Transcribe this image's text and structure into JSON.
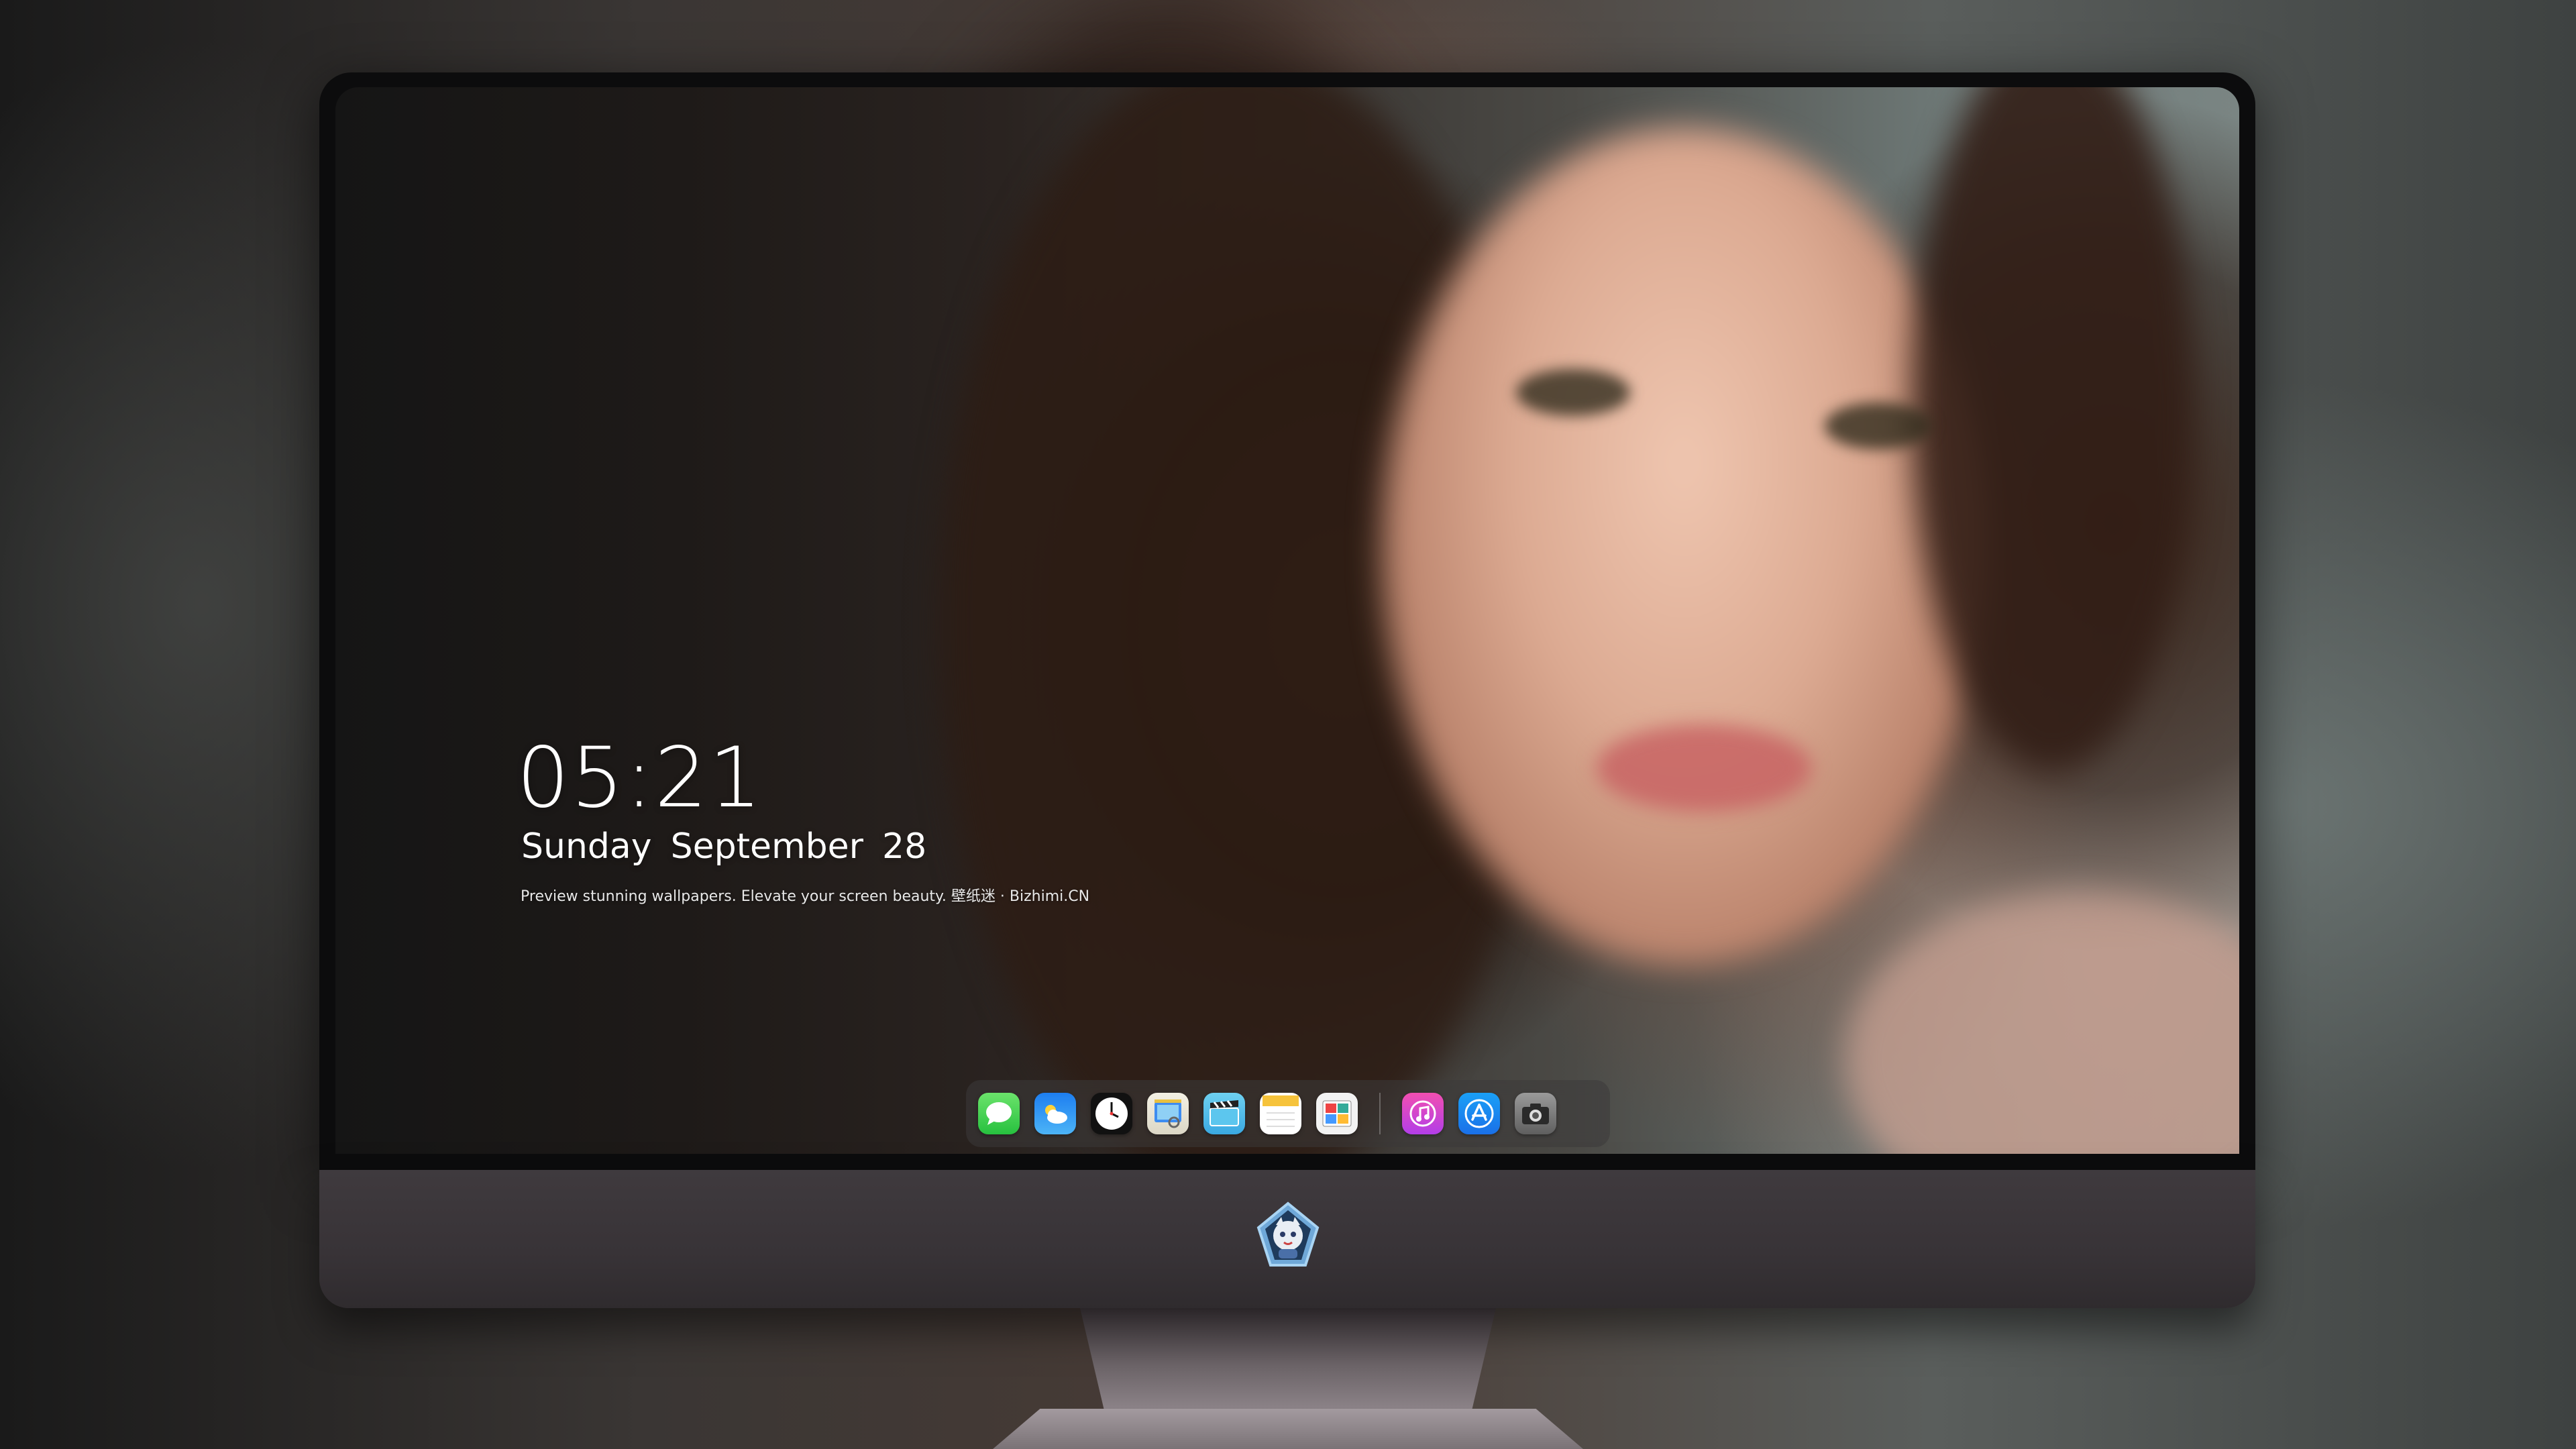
{
  "lockscreen": {
    "time": "05:21",
    "weekday": "Sunday",
    "month": "September",
    "day": "28",
    "tagline": "Preview stunning wallpapers. Elevate your screen beauty. 壁纸迷 · Bizhimi.CN"
  },
  "dock": {
    "apps": [
      {
        "icon": "messages-icon"
      },
      {
        "icon": "weather-icon"
      },
      {
        "icon": "clock-icon"
      },
      {
        "icon": "preview-icon"
      },
      {
        "icon": "clips-icon"
      },
      {
        "icon": "notes-icon"
      },
      {
        "icon": "photo-booth-icon"
      },
      {
        "icon": "music-icon"
      },
      {
        "icon": "app-store-icon"
      },
      {
        "icon": "camera-icon"
      }
    ]
  },
  "device": {
    "chin_logo": "mascot-logo-icon"
  }
}
